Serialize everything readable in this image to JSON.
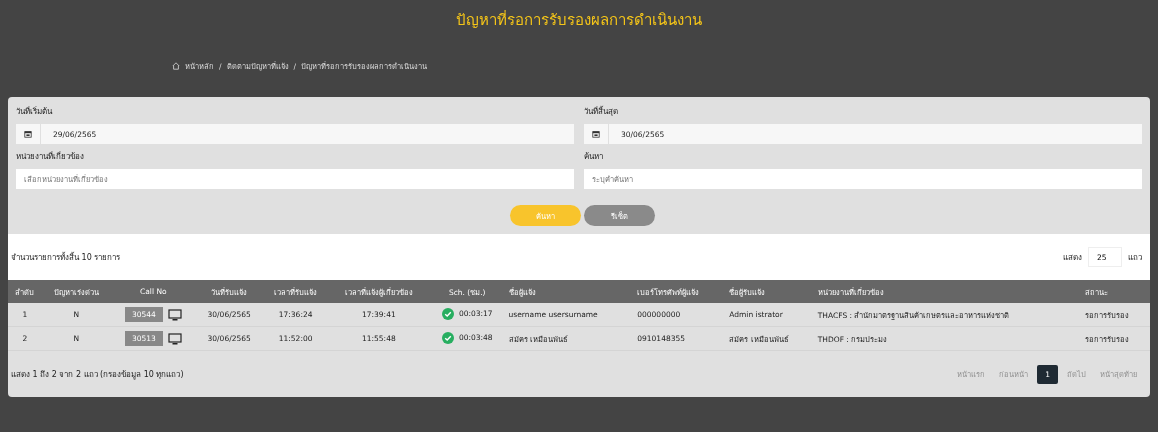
{
  "header": {
    "title": "ปัญหาที่รอการรับรองผลการดำเนินงาน",
    "breadcrumb_separator": "/",
    "breadcrumb": [
      "หน้าหลัก",
      "ติดตามปัญหาที่แจ้ง",
      "ปัญหาที่รอการรับรองผลการดำเนินงาน"
    ]
  },
  "filters": [
    {
      "label": "วันที่เริ่มต้น",
      "kind": "date",
      "value": "29/06/2565"
    },
    {
      "label": "วันที่สิ้นสุด",
      "kind": "date",
      "value": "30/06/2565"
    },
    {
      "label": "หน่วยงานที่เกี่ยวข้อง",
      "kind": "text",
      "placeholder": "เลือกหน่วยงานที่เกี่ยวข้อง"
    },
    {
      "label": "ค้นหา",
      "kind": "text",
      "placeholder": "ระบุคำค้นหา"
    }
  ],
  "buttons": [
    {
      "label": "ค้นหา",
      "kind": "primary"
    },
    {
      "label": "รีเซ็ต",
      "kind": "secondary"
    }
  ],
  "summary": "จำนวนรายการทั้งสิ้น 10 รายการ",
  "page_size": {
    "label": "แสดง",
    "value": "25",
    "unit": "แถว"
  },
  "table": {
    "columns": [
      "ลำดับ",
      "ปัญหาเร่งด่วน",
      "Call No",
      "วันที่รับแจ้ง",
      "เวลาที่รับแจ้ง",
      "เวลาที่แจ้งผู้เกี่ยวข้อง",
      "Sch. (ชม.)",
      "ชื่อผู้แจ้ง",
      "เบอร์โทรศัพท์ผู้แจ้ง",
      "ชื่อผู้รับแจ้ง",
      "หน่วยงานที่เกี่ยวข้อง",
      "สถานะ"
    ],
    "rows": [
      {
        "no": "1",
        "urgent": "N",
        "call_no": "30544",
        "date": "30/06/2565",
        "time": "17:36:24",
        "notify_time": "17:39:41",
        "sch": "00:03:17",
        "sch_ok": true,
        "reporter": "username usersurname",
        "phone": "000000000",
        "receiver": "Admin istrator",
        "agency": "THACFS : สำนักมาตรฐานสินค้าเกษตรและอาหารแห่งชาติ",
        "status": "รอการรับรอง"
      },
      {
        "no": "2",
        "urgent": "N",
        "call_no": "30513",
        "date": "30/06/2565",
        "time": "11:52:00",
        "notify_time": "11:55:48",
        "sch": "00:03:48",
        "sch_ok": true,
        "reporter": "สมัคร เหมือนพันธ์",
        "phone": "0910148355",
        "receiver": "สมัคร เหมือนพันธ์",
        "agency": "THDOF : กรมประมง",
        "status": "รอการรับรอง"
      }
    ]
  },
  "footer_info": "แสดง 1 ถึง 2 จาก 2 แถว (กรองข้อมูล 10 ทุกแถว)",
  "pagination": [
    {
      "label": "หน้าแรก",
      "disabled": true,
      "selected": false
    },
    {
      "label": "ก่อนหน้า",
      "disabled": true,
      "selected": false
    },
    {
      "label": "1",
      "disabled": false,
      "selected": true
    },
    {
      "label": "ถัดไป",
      "disabled": true,
      "selected": false
    },
    {
      "label": "หน้าสุดท้าย",
      "disabled": true,
      "selected": false
    }
  ]
}
